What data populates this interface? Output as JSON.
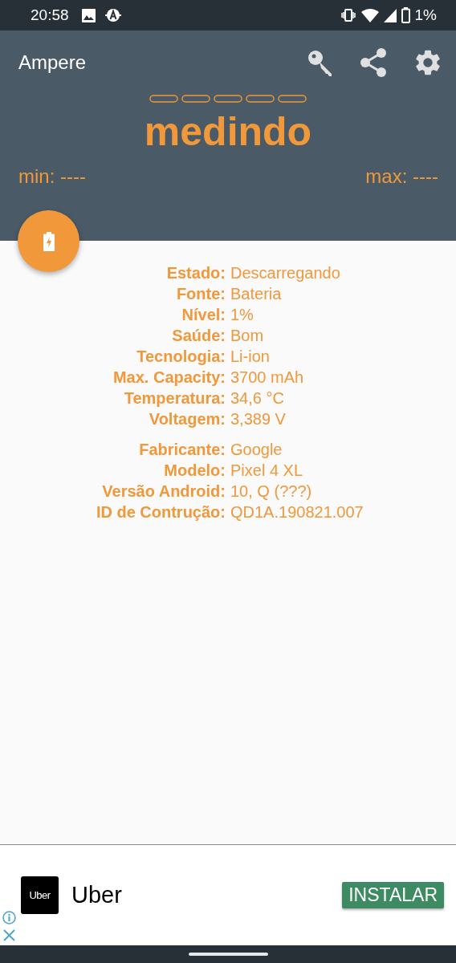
{
  "status_bar": {
    "time": "20:58",
    "battery_text": "1%"
  },
  "app_bar": {
    "title": "Ampere"
  },
  "reading": {
    "value": "medindo",
    "min": "min: ----",
    "max": "max: ----"
  },
  "info_groups": [
    {
      "rows": [
        {
          "label": "Estado:",
          "value": "Descarregando"
        },
        {
          "label": "Fonte:",
          "value": "Bateria"
        },
        {
          "label": "Nível:",
          "value": "1%"
        },
        {
          "label": "Saúde:",
          "value": "Bom"
        },
        {
          "label": "Tecnologia:",
          "value": "Li-ion"
        },
        {
          "label": "Max. Capacity:",
          "value": "3700 mAh"
        },
        {
          "label": "Temperatura:",
          "value": "34,6 °C"
        },
        {
          "label": "Voltagem:",
          "value": "3,389 V"
        }
      ]
    },
    {
      "rows": [
        {
          "label": "Fabricante:",
          "value": "Google"
        },
        {
          "label": "Modelo:",
          "value": "Pixel 4 XL"
        },
        {
          "label": "Versão Android:",
          "value": "10, Q (???)"
        },
        {
          "label": "ID de Contrução:",
          "value": "QD1A.190821.007"
        }
      ]
    }
  ],
  "ad": {
    "logo_text": "Uber",
    "name": "Uber",
    "button": "INSTALAR"
  }
}
